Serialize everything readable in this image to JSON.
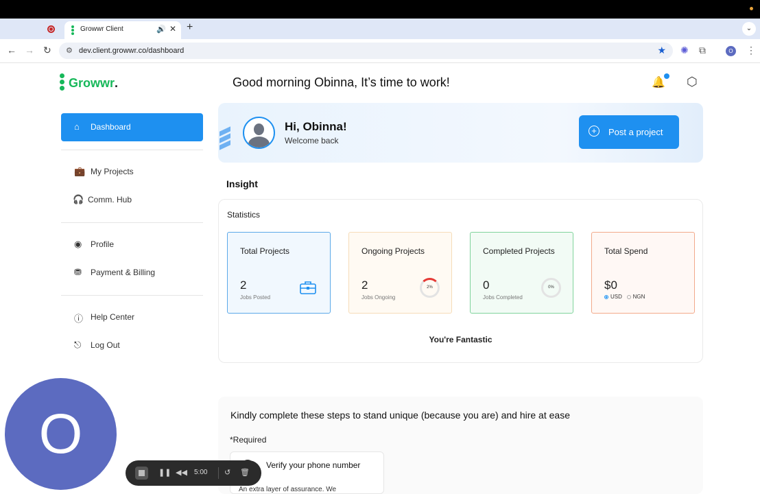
{
  "browser": {
    "tab_title": "Growwr Client",
    "url": "dev.client.growwr.co/dashboard",
    "profile_initial": "O"
  },
  "app": {
    "logo_text": "Growwr",
    "logo_dot": ".",
    "greeting": "Good morning Obinna, It’s time to work!"
  },
  "sidebar": {
    "items": [
      {
        "label": "Dashboard",
        "icon": "dashboard-icon"
      },
      {
        "label": "My Projects",
        "icon": "briefcase-icon"
      },
      {
        "label": "Comm. Hub",
        "icon": "headset-icon"
      },
      {
        "label": "Profile",
        "icon": "user-icon"
      },
      {
        "label": "Payment & Billing",
        "icon": "billing-icon"
      },
      {
        "label": "Help Center",
        "icon": "help-icon"
      },
      {
        "label": "Log Out",
        "icon": "logout-icon"
      }
    ]
  },
  "welcome": {
    "title": "Hi, Obinna!",
    "subtitle": "Welcome back",
    "post_button": "Post a project"
  },
  "insight": {
    "heading": "Insight",
    "statistics_label": "Statistics",
    "cards": [
      {
        "title": "Total Projects",
        "value": "2",
        "sub": "Jobs Posted"
      },
      {
        "title": "Ongoing Projects",
        "value": "2",
        "sub": "Jobs Ongoing",
        "ring": "2%"
      },
      {
        "title": "Completed Projects",
        "value": "0",
        "sub": "Jobs Completed",
        "ring": "0%"
      },
      {
        "title": "Total Spend",
        "value": "$0",
        "currencies": [
          "USD",
          "NGN"
        ],
        "selected_currency": "USD"
      }
    ],
    "footer_text": "You're Fantastic"
  },
  "steps": {
    "heading": "Kindly complete these steps to stand unique (because you are) and hire at ease",
    "required_label": "*Required",
    "card_title": "Verify your phone number",
    "card_desc": "An extra layer of assurance. We"
  },
  "recorder": {
    "avatar_letter": "O",
    "time": "5:00"
  },
  "colors": {
    "brand_green": "#17b85a",
    "primary_blue": "#1e90f0",
    "avatar_purple": "#5c6bc0",
    "card_blue_border": "#5aa8e8",
    "card_orange_border": "#f6dcb8",
    "card_green_border": "#7fd39b",
    "card_red_border": "#f2a98a"
  }
}
